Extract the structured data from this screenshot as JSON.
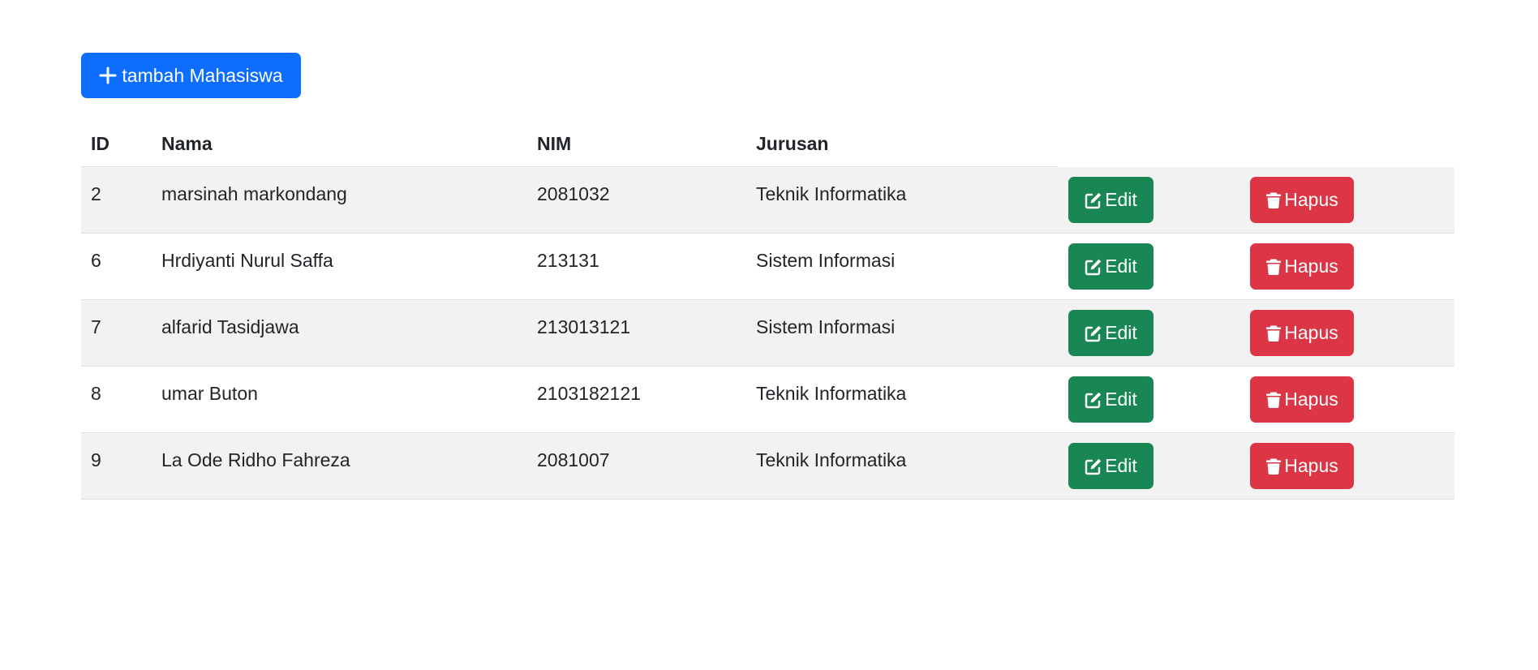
{
  "toolbar": {
    "add_label": "tambah Mahasiswa",
    "add_icon": "plus-icon",
    "add_color": "#0d6efd"
  },
  "table": {
    "headers": {
      "id": "ID",
      "nama": "Nama",
      "nim": "NIM",
      "jurusan": "Jurusan"
    },
    "edit_label": "Edit",
    "edit_icon": "edit-icon",
    "edit_color": "#198754",
    "hapus_label": "Hapus",
    "hapus_icon": "trash-icon",
    "hapus_color": "#dc3545",
    "rows": [
      {
        "id": "2",
        "nama": "marsinah markondang",
        "nim": "2081032",
        "jurusan": "Teknik Informatika"
      },
      {
        "id": "6",
        "nama": "Hrdiyanti Nurul Saffa",
        "nim": "213131",
        "jurusan": "Sistem Informasi"
      },
      {
        "id": "7",
        "nama": "alfarid Tasidjawa",
        "nim": "213013121",
        "jurusan": "Sistem Informasi"
      },
      {
        "id": "8",
        "nama": "umar Buton",
        "nim": "2103182121",
        "jurusan": "Teknik Informatika"
      },
      {
        "id": "9",
        "nama": "La Ode Ridho Fahreza",
        "nim": "2081007",
        "jurusan": "Teknik Informatika"
      }
    ]
  }
}
